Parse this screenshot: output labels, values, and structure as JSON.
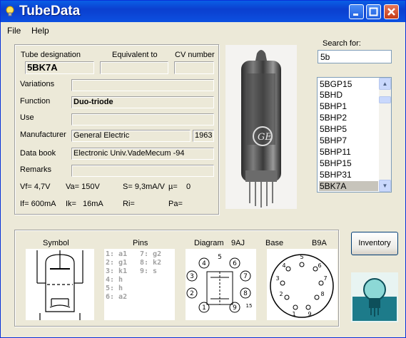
{
  "window": {
    "title": "TubeData"
  },
  "menu": {
    "file": "File",
    "help": "Help"
  },
  "labels": {
    "tube_designation": "Tube designation",
    "equivalent_to": "Equivalent to",
    "cv_number": "CV number",
    "variations": "Variations",
    "function": "Function",
    "use": "Use",
    "manufacturer": "Manufacturer",
    "data_book": "Data book",
    "remarks": "Remarks",
    "search_for": "Search for:",
    "symbol": "Symbol",
    "pins": "Pins",
    "diagram": "Diagram",
    "base": "Base"
  },
  "values": {
    "tube_designation": "5BK7A",
    "equivalent_to": "",
    "cv_number": "",
    "variations": "",
    "function": "Duo-triode",
    "use": "",
    "manufacturer": "General Electric",
    "year": "1963",
    "data_book": "Electronic Univ.VadeMecum -94",
    "remarks": ""
  },
  "params": {
    "vf": "Vf= 4,7V",
    "va": "Va= 150V",
    "s": "S= 9,3mA/V",
    "mu": "µ=",
    "mu_val": "0",
    "if": "If= 600mA",
    "ik": "Ik=",
    "ik_val": "16mA",
    "ri": "Ri=",
    "pa": "Pa="
  },
  "search": {
    "value": "5b"
  },
  "list": [
    "5BGP15",
    "5BHD",
    "5BHP1",
    "5BHP2",
    "5BHP5",
    "5BHP7",
    "5BHP11",
    "5BHP15",
    "5BHP31",
    "5BK7A"
  ],
  "pins": {
    "left": [
      "1: a1",
      "2: g1",
      "3: k1",
      "4: h",
      "5: h",
      "6: a2"
    ],
    "right": [
      "7: g2",
      "8: k2",
      "9: s"
    ]
  },
  "diagram": {
    "code": "9AJ"
  },
  "base": {
    "code": "B9A"
  },
  "buttons": {
    "inventory": "Inventory"
  }
}
